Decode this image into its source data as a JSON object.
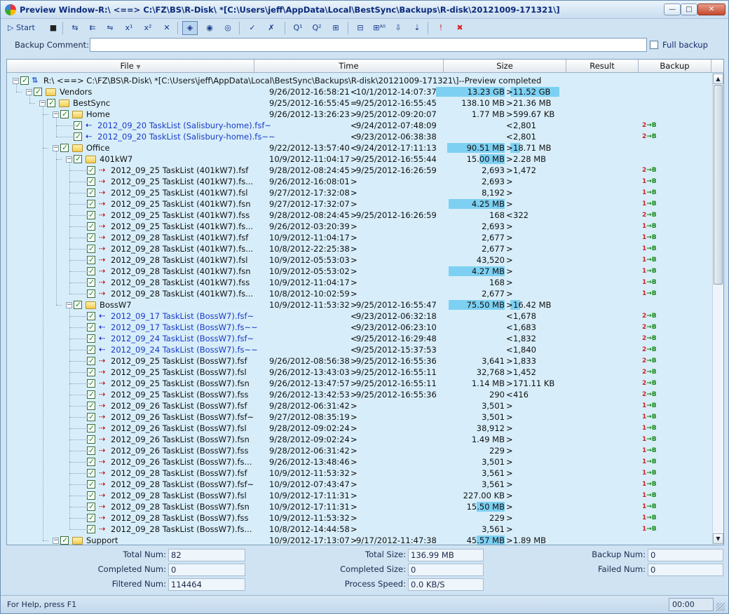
{
  "window": {
    "title": "Preview Window-R:\\ <==> C:\\FZ\\BS\\R-Disk\\ *[C:\\Users\\jeff\\AppData\\Local\\BestSync\\Backups\\R-disk\\20121009-171321\\]",
    "minimize": "—",
    "maximize": "□",
    "close": "✕"
  },
  "toolbar": {
    "start_label": "Start",
    "buttons": [
      "stop-icon",
      "copy-left-right-icon",
      "copy-right-icon",
      "exchange-icon",
      "x1-icon",
      "x2-icon",
      "delete-icon",
      "view-changes-icon",
      "view-all-icon",
      "view-filter-icon",
      "check-icon",
      "uncheck-icon",
      "q1-icon",
      "q2-icon",
      "compare-icon",
      "expand-icon",
      "expand-all-icon",
      "goto-down-icon",
      "goto-next-icon",
      "error-icon",
      "cancel-icon"
    ],
    "glyphs": [
      "■",
      "⇆",
      "⇇",
      "⇋",
      "x¹",
      "x²",
      "✕",
      "◈",
      "◉",
      "◎",
      "✓",
      "✗",
      "Q¹",
      "Q²",
      "⊞",
      "⊟",
      "⊞ᴬˡˡ",
      "⇩",
      "⇣",
      "!",
      "✖"
    ]
  },
  "comment": {
    "label": "Backup Comment:",
    "value": "",
    "full_backup_label": "Full backup"
  },
  "columns": [
    "File",
    "Time",
    "Size",
    "Result",
    "Backup"
  ],
  "rows": [
    {
      "d": 0,
      "type": "root",
      "name": "R:\\ <==> C:\\FZ\\BS\\R-Disk\\ *[C:\\Users\\jeff\\AppData\\Local\\BestSync\\Backups\\R-disk\\20121009-171321\\]--Preview completed"
    },
    {
      "d": 1,
      "type": "folder",
      "name": "Vendors",
      "tl": "9/26/2012-16:58:21",
      "op": "<",
      "tr": "10/1/2012-14:07:37",
      "sl": "13.23 GB",
      "sop": ">",
      "sr": "11.52 GB",
      "bl": 98,
      "br": 70
    },
    {
      "d": 2,
      "type": "folder",
      "name": "BestSync",
      "tl": "9/25/2012-16:55:45",
      "op": "=",
      "tr": "9/25/2012-16:55:45",
      "sl": "138.10 MB",
      "sop": ">",
      "sr": "21.36 MB"
    },
    {
      "d": 3,
      "type": "folder",
      "name": "Home",
      "tl": "9/26/2012-13:26:23",
      "op": ">",
      "tr": "9/25/2012-09:20:07",
      "sl": "1.77 MB",
      "sop": ">",
      "sr": "599.67 KB"
    },
    {
      "d": 4,
      "type": "file",
      "blue": true,
      "arr": "l",
      "name": "2012_09_20 TaskList (Salisbury-home).fsf~",
      "tl": "",
      "op": "<",
      "tr": "9/24/2012-07:48:09",
      "sl": "",
      "sop": "<",
      "sr": "2,801",
      "res": "2"
    },
    {
      "d": 4,
      "type": "file",
      "blue": true,
      "arr": "l",
      "name": "2012_09_20 TaskList (Salisbury-home).fs~~",
      "tl": "",
      "op": "<",
      "tr": "9/23/2012-06:38:38",
      "sl": "",
      "sop": "<",
      "sr": "2,801",
      "res": "2"
    },
    {
      "d": 3,
      "type": "folder",
      "name": "Office",
      "tl": "9/22/2012-13:57:40",
      "op": "<",
      "tr": "9/24/2012-17:11:13",
      "sl": "90.51 MB",
      "sop": ">",
      "sr": "18.71 MB",
      "bl": 82,
      "br": 14
    },
    {
      "d": 4,
      "type": "folder",
      "name": "401kW7",
      "tl": "10/9/2012-11:04:17",
      "op": ">",
      "tr": "9/25/2012-16:55:44",
      "sl": "15.00 MB",
      "sop": ">",
      "sr": "2.28 MB",
      "bl": 36
    },
    {
      "d": 5,
      "type": "file",
      "arr": "r",
      "name": "2012_09_25 TaskList (401kW7).fsf",
      "tl": "9/28/2012-08:24:45",
      "op": ">",
      "tr": "9/25/2012-16:26:59",
      "sl": "2,693",
      "sop": ">",
      "sr": "1,472",
      "res": "2"
    },
    {
      "d": 5,
      "type": "file",
      "arr": "r",
      "name": "2012_09_25 TaskList (401kW7).fs...",
      "tl": "9/26/2012-16:08:01",
      "op": ">",
      "tr": "",
      "sl": "2,693",
      "sop": ">",
      "sr": "",
      "res": "1"
    },
    {
      "d": 5,
      "type": "file",
      "arr": "r",
      "name": "2012_09_25 TaskList (401kW7).fsl",
      "tl": "9/27/2012-17:32:08",
      "op": ">",
      "tr": "",
      "sl": "8,192",
      "sop": ">",
      "sr": "",
      "res": "1"
    },
    {
      "d": 5,
      "type": "file",
      "arr": "r",
      "name": "2012_09_25 TaskList (401kW7).fsn",
      "tl": "9/27/2012-17:32:07",
      "op": ">",
      "tr": "",
      "sl": "4.25 MB",
      "sop": ">",
      "sr": "",
      "res": "1",
      "bl": 80
    },
    {
      "d": 5,
      "type": "file",
      "arr": "r",
      "name": "2012_09_25 TaskList (401kW7).fss",
      "tl": "9/28/2012-08:24:45",
      "op": ">",
      "tr": "9/25/2012-16:26:59",
      "sl": "168",
      "sop": "<",
      "sr": "322",
      "res": "2"
    },
    {
      "d": 5,
      "type": "file",
      "arr": "r",
      "name": "2012_09_25 TaskList (401kW7).fs...",
      "tl": "9/26/2012-03:20:39",
      "op": ">",
      "tr": "",
      "sl": "2,693",
      "sop": ">",
      "sr": "",
      "res": "1"
    },
    {
      "d": 5,
      "type": "file",
      "arr": "r",
      "name": "2012_09_28 TaskList (401kW7).fsf",
      "tl": "10/9/2012-11:04:17",
      "op": ">",
      "tr": "",
      "sl": "2,677",
      "sop": ">",
      "sr": "",
      "res": "1"
    },
    {
      "d": 5,
      "type": "file",
      "arr": "r",
      "name": "2012_09_28 TaskList (401kW7).fs...",
      "tl": "10/8/2012-22:25:38",
      "op": ">",
      "tr": "",
      "sl": "2,677",
      "sop": ">",
      "sr": "",
      "res": "1"
    },
    {
      "d": 5,
      "type": "file",
      "arr": "r",
      "name": "2012_09_28 TaskList (401kW7).fsl",
      "tl": "10/9/2012-05:53:03",
      "op": ">",
      "tr": "",
      "sl": "43,520",
      "sop": ">",
      "sr": "",
      "res": "1"
    },
    {
      "d": 5,
      "type": "file",
      "arr": "r",
      "name": "2012_09_28 TaskList (401kW7).fsn",
      "tl": "10/9/2012-05:53:02",
      "op": ">",
      "tr": "",
      "sl": "4.27 MB",
      "sop": ">",
      "sr": "",
      "res": "1",
      "bl": 80
    },
    {
      "d": 5,
      "type": "file",
      "arr": "r",
      "name": "2012_09_28 TaskList (401kW7).fss",
      "tl": "10/9/2012-11:04:17",
      "op": ">",
      "tr": "",
      "sl": "168",
      "sop": ">",
      "sr": "",
      "res": "1"
    },
    {
      "d": 5,
      "type": "file",
      "arr": "r",
      "name": "2012_09_28 TaskList (401kW7).fs...",
      "tl": "10/8/2012-10:02:59",
      "op": ">",
      "tr": "",
      "sl": "2,677",
      "sop": ">",
      "sr": "",
      "res": "1"
    },
    {
      "d": 4,
      "type": "folder",
      "name": "BossW7",
      "tl": "10/9/2012-11:53:32",
      "op": ">",
      "tr": "9/25/2012-16:55:47",
      "sl": "75.50 MB",
      "sop": ">",
      "sr": "16.42 MB",
      "bl": 80,
      "br": 14
    },
    {
      "d": 5,
      "type": "file",
      "blue": true,
      "arr": "l",
      "name": "2012_09_17 TaskList (BossW7).fsf~",
      "tl": "",
      "op": "<",
      "tr": "9/23/2012-06:32:18",
      "sl": "",
      "sop": "<",
      "sr": "1,678",
      "res": "2"
    },
    {
      "d": 5,
      "type": "file",
      "blue": true,
      "arr": "l",
      "name": "2012_09_17 TaskList (BossW7).fs~~",
      "tl": "",
      "op": "<",
      "tr": "9/23/2012-06:23:10",
      "sl": "",
      "sop": "<",
      "sr": "1,683",
      "res": "2"
    },
    {
      "d": 5,
      "type": "file",
      "blue": true,
      "arr": "l",
      "name": "2012_09_24 TaskList (BossW7).fsf~",
      "tl": "",
      "op": "<",
      "tr": "9/25/2012-16:29:48",
      "sl": "",
      "sop": "<",
      "sr": "1,832",
      "res": "2"
    },
    {
      "d": 5,
      "type": "file",
      "blue": true,
      "arr": "l",
      "name": "2012_09_24 TaskList (BossW7).fs~~",
      "tl": "",
      "op": "<",
      "tr": "9/25/2012-15:37:53",
      "sl": "",
      "sop": "<",
      "sr": "1,840",
      "res": "2"
    },
    {
      "d": 5,
      "type": "file",
      "arr": "r",
      "name": "2012_09_25 TaskList (BossW7).fsf",
      "tl": "9/26/2012-08:56:38",
      "op": ">",
      "tr": "9/25/2012-16:55:36",
      "sl": "3,641",
      "sop": ">",
      "sr": "1,833",
      "res": "2"
    },
    {
      "d": 5,
      "type": "file",
      "arr": "r",
      "name": "2012_09_25 TaskList (BossW7).fsl",
      "tl": "9/26/2012-13:43:03",
      "op": ">",
      "tr": "9/25/2012-16:55:11",
      "sl": "32,768",
      "sop": ">",
      "sr": "1,452",
      "res": "2"
    },
    {
      "d": 5,
      "type": "file",
      "arr": "r",
      "name": "2012_09_25 TaskList (BossW7).fsn",
      "tl": "9/26/2012-13:47:57",
      "op": ">",
      "tr": "9/25/2012-16:55:11",
      "sl": "1.14 MB",
      "sop": ">",
      "sr": "171.11 KB",
      "res": "2"
    },
    {
      "d": 5,
      "type": "file",
      "arr": "r",
      "name": "2012_09_25 TaskList (BossW7).fss",
      "tl": "9/26/2012-13:42:53",
      "op": ">",
      "tr": "9/25/2012-16:55:36",
      "sl": "290",
      "sop": "<",
      "sr": "416",
      "res": "2"
    },
    {
      "d": 5,
      "type": "file",
      "arr": "r",
      "name": "2012_09_26 TaskList (BossW7).fsf",
      "tl": "9/28/2012-06:31:42",
      "op": ">",
      "tr": "",
      "sl": "3,501",
      "sop": ">",
      "sr": "",
      "res": "1"
    },
    {
      "d": 5,
      "type": "file",
      "arr": "r",
      "name": "2012_09_26 TaskList (BossW7).fsf~",
      "tl": "9/27/2012-08:35:19",
      "op": ">",
      "tr": "",
      "sl": "3,501",
      "sop": ">",
      "sr": "",
      "res": "1"
    },
    {
      "d": 5,
      "type": "file",
      "arr": "r",
      "name": "2012_09_26 TaskList (BossW7).fsl",
      "tl": "9/28/2012-09:02:24",
      "op": ">",
      "tr": "",
      "sl": "38,912",
      "sop": ">",
      "sr": "",
      "res": "1"
    },
    {
      "d": 5,
      "type": "file",
      "arr": "r",
      "name": "2012_09_26 TaskList (BossW7).fsn",
      "tl": "9/28/2012-09:02:24",
      "op": ">",
      "tr": "",
      "sl": "1.49 MB",
      "sop": ">",
      "sr": "",
      "res": "1"
    },
    {
      "d": 5,
      "type": "file",
      "arr": "r",
      "name": "2012_09_26 TaskList (BossW7).fss",
      "tl": "9/28/2012-06:31:42",
      "op": ">",
      "tr": "",
      "sl": "229",
      "sop": ">",
      "sr": "",
      "res": "1"
    },
    {
      "d": 5,
      "type": "file",
      "arr": "r",
      "name": "2012_09_26 TaskList (BossW7).fs...",
      "tl": "9/26/2012-13:48:46",
      "op": ">",
      "tr": "",
      "sl": "3,501",
      "sop": ">",
      "sr": "",
      "res": "1"
    },
    {
      "d": 5,
      "type": "file",
      "arr": "r",
      "name": "2012_09_28 TaskList (BossW7).fsf",
      "tl": "10/9/2012-11:53:32",
      "op": ">",
      "tr": "",
      "sl": "3,561",
      "sop": ">",
      "sr": "",
      "res": "1"
    },
    {
      "d": 5,
      "type": "file",
      "arr": "r",
      "name": "2012_09_28 TaskList (BossW7).fsf~",
      "tl": "10/9/2012-07:43:47",
      "op": ">",
      "tr": "",
      "sl": "3,561",
      "sop": ">",
      "sr": "",
      "res": "1"
    },
    {
      "d": 5,
      "type": "file",
      "arr": "r",
      "name": "2012_09_28 TaskList (BossW7).fsl",
      "tl": "10/9/2012-17:11:31",
      "op": ">",
      "tr": "",
      "sl": "227.00 KB",
      "sop": ">",
      "sr": "",
      "res": "1"
    },
    {
      "d": 5,
      "type": "file",
      "arr": "r",
      "name": "2012_09_28 TaskList (BossW7).fsn",
      "tl": "10/9/2012-17:11:31",
      "op": ">",
      "tr": "",
      "sl": "15.50 MB",
      "sop": ">",
      "sr": "",
      "res": "1",
      "bl": 40
    },
    {
      "d": 5,
      "type": "file",
      "arr": "r",
      "name": "2012_09_28 TaskList (BossW7).fss",
      "tl": "10/9/2012-11:53:32",
      "op": ">",
      "tr": "",
      "sl": "229",
      "sop": ">",
      "sr": "",
      "res": "1"
    },
    {
      "d": 5,
      "type": "file",
      "arr": "r",
      "name": "2012_09_28 TaskList (BossW7).fs...",
      "tl": "10/8/2012-14:44:58",
      "op": ">",
      "tr": "",
      "sl": "3,561",
      "sop": ">",
      "sr": "",
      "res": "1"
    },
    {
      "d": 3,
      "type": "folder",
      "name": "Support",
      "tl": "10/9/2012-17:13:07",
      "op": ">",
      "tr": "9/17/2012-11:47:38",
      "sl": "45.57 MB",
      "sop": ">",
      "sr": "1.89 MB",
      "bl": 40
    }
  ],
  "stats": {
    "total_num_label": "Total Num:",
    "total_num": "82",
    "completed_num_label": "Completed Num:",
    "completed_num": "0",
    "filtered_num_label": "Filtered Num:",
    "filtered_num": "114464",
    "total_size_label": "Total Size:",
    "total_size": "136.99 MB",
    "completed_size_label": "Completed Size:",
    "completed_size": "0",
    "process_speed_label": "Process Speed:",
    "process_speed": "0.0 KB/S",
    "backup_num_label": "Backup Num:",
    "backup_num": "0",
    "failed_num_label": "Failed Num:",
    "failed_num": "0"
  },
  "statusbar": {
    "help": "For Help, press F1",
    "time": "00:00"
  },
  "colors": {
    "size_bar": "#7dd0f2",
    "tree_bg": "#d7eefa",
    "frame_bg": "#cfe3f3",
    "new_item_text": "#1a3ac8"
  }
}
